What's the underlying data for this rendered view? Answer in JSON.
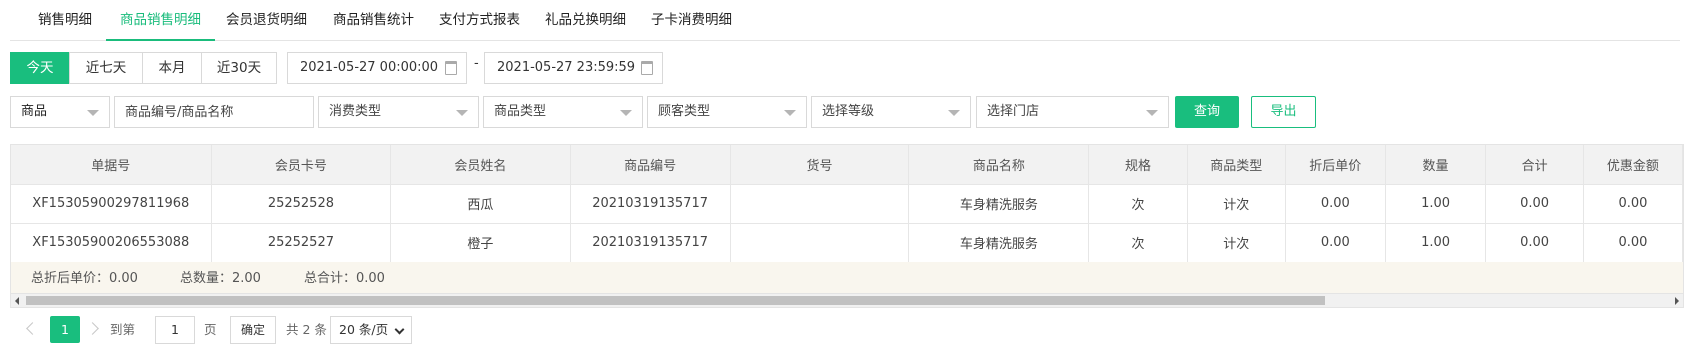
{
  "tabs": [
    {
      "label": "销售明细",
      "active": false
    },
    {
      "label": "商品销售明细",
      "active": true
    },
    {
      "label": "会员退货明细",
      "active": false
    },
    {
      "label": "商品销售统计",
      "active": false
    },
    {
      "label": "支付方式报表",
      "active": false
    },
    {
      "label": "礼品兑换明细",
      "active": false
    },
    {
      "label": "子卡消费明细",
      "active": false
    }
  ],
  "quick_range": [
    {
      "label": "今天",
      "active": true
    },
    {
      "label": "近七天",
      "active": false
    },
    {
      "label": "本月",
      "active": false
    },
    {
      "label": "近30天",
      "active": false
    }
  ],
  "date_range": {
    "start": "2021-05-27 00:00:00",
    "separator": "-",
    "end": "2021-05-27 23:59:59"
  },
  "filters": {
    "search_type": "商品",
    "search_placeholder": "商品编号/商品名称",
    "consume_type": "消费类型",
    "product_type": "商品类型",
    "customer_type": "顾客类型",
    "level": "选择等级",
    "store": "选择门店"
  },
  "buttons": {
    "query": "查询",
    "export": "导出"
  },
  "table": {
    "columns": [
      "单据号",
      "会员卡号",
      "会员姓名",
      "商品编号",
      "货号",
      "商品名称",
      "规格",
      "商品类型",
      "折后单价",
      "数量",
      "合计",
      "优惠金额"
    ],
    "rows": [
      [
        "XF15305900297811968",
        "25252528",
        "西瓜",
        "20210319135717",
        "",
        "车身精洗服务",
        "次",
        "计次",
        "0.00",
        "1.00",
        "0.00",
        "0.00"
      ],
      [
        "XF15305900206553088",
        "25252527",
        "橙子",
        "20210319135717",
        "",
        "车身精洗服务",
        "次",
        "计次",
        "0.00",
        "1.00",
        "0.00",
        "0.00"
      ]
    ]
  },
  "summary": {
    "unit_price": "总折后单价：0.00",
    "quantity": "总数量：2.00",
    "total": "总合计：0.00"
  },
  "pagination": {
    "current_page": "1",
    "goto_label": "到第",
    "goto_value": "1",
    "page_unit": "页",
    "confirm": "确定",
    "total_text": "共 2 条",
    "page_size": "20 条/页"
  },
  "colors": {
    "accent": "#19be7e",
    "summary_bg": "#f9f6ee",
    "header_bg": "#f2f2f2"
  }
}
